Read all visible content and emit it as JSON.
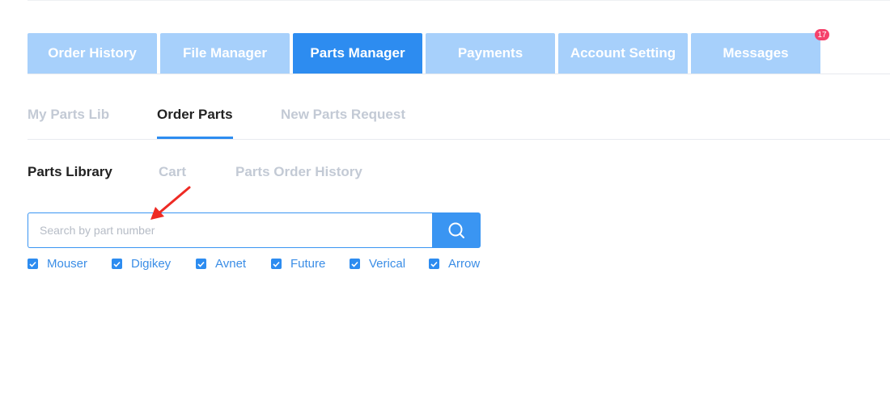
{
  "main_tabs": [
    {
      "label": "Order History"
    },
    {
      "label": "File Manager"
    },
    {
      "label": "Parts Manager",
      "active": true
    },
    {
      "label": "Payments"
    },
    {
      "label": "Account Setting"
    },
    {
      "label": "Messages",
      "badge": "17"
    }
  ],
  "sub_tabs": [
    {
      "label": "My Parts Lib"
    },
    {
      "label": "Order Parts",
      "active": true
    },
    {
      "label": "New Parts Request"
    }
  ],
  "library_tabs": [
    {
      "label": "Parts Library",
      "active": true
    },
    {
      "label": "Cart"
    },
    {
      "label": "Parts Order History"
    }
  ],
  "search": {
    "placeholder": "Search by part number",
    "value": "",
    "button_icon": "search-icon"
  },
  "suppliers": [
    {
      "label": "Mouser",
      "checked": true
    },
    {
      "label": "Digikey",
      "checked": true
    },
    {
      "label": "Avnet",
      "checked": true
    },
    {
      "label": "Future",
      "checked": true
    },
    {
      "label": "Verical",
      "checked": true
    },
    {
      "label": "Arrow",
      "checked": true
    }
  ],
  "annotation": {
    "icon": "red-arrow-icon",
    "color": "#ee2a24"
  },
  "colors": {
    "primary": "#2d8cf0",
    "tab_inactive": "#a7d0fb",
    "badge": "#f5426c",
    "muted_text": "#c3cad5"
  }
}
